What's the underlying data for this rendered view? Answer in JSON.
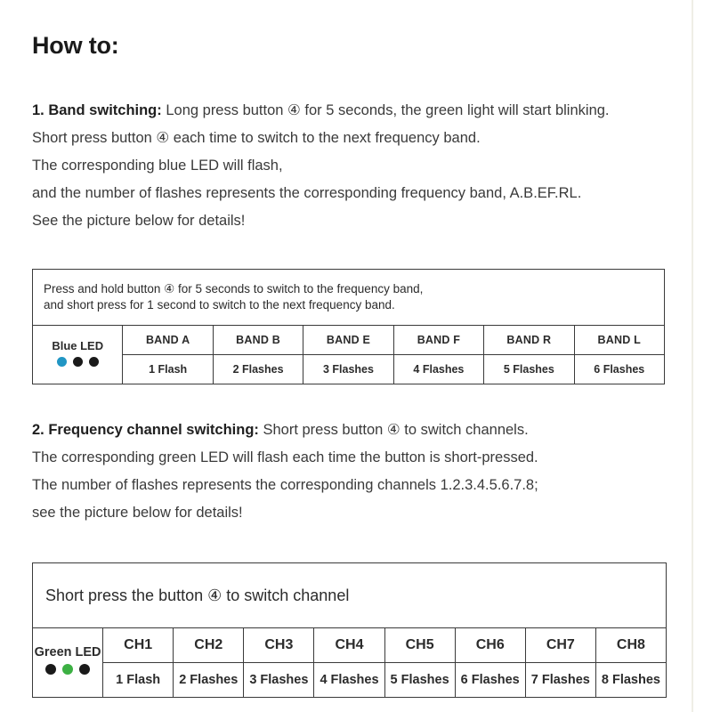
{
  "page": {
    "title": "How to:"
  },
  "section1": {
    "lead": "1. Band switching:",
    "line1_rest": " Long press button ④ for 5 seconds, the green light will start blinking.",
    "line2": "Short press button ④ each time to switch to the next frequency band.",
    "line3": "The corresponding blue LED will flash,",
    "line4": "and the number of flashes represents the corresponding frequency band, A.B.EF.RL.",
    "line5": "See the picture below for details!"
  },
  "band_table": {
    "note_line1": "Press and hold button ④ for 5 seconds to switch to the frequency band,",
    "note_line2": "and short press for 1 second to switch to the next frequency band.",
    "led_label": "Blue LED",
    "led_colors": [
      "#2196c4",
      "#1a1a1a",
      "#1a1a1a"
    ],
    "bands": [
      "BAND A",
      "BAND B",
      "BAND E",
      "BAND F",
      "BAND R",
      "BAND L"
    ],
    "flashes": [
      "1 Flash",
      "2 Flashes",
      "3 Flashes",
      "4 Flashes",
      "5 Flashes",
      "6 Flashes"
    ]
  },
  "section2": {
    "lead": "2. Frequency channel switching:",
    "line1_rest": " Short press button ④ to switch channels.",
    "line2": "The corresponding green LED will flash each time the button is short-pressed.",
    "line3": "The number of flashes represents the corresponding channels  1.2.3.4.5.6.7.8;",
    "line4": "see the picture below for details!"
  },
  "channel_table": {
    "note": "Short press the button ④ to switch channel",
    "led_label": "Green LED",
    "led_colors": [
      "#1a1a1a",
      "#3cb043",
      "#1a1a1a"
    ],
    "channels": [
      "CH1",
      "CH2",
      "CH3",
      "CH4",
      "CH5",
      "CH6",
      "CH7",
      "CH8"
    ],
    "flashes": [
      "1 Flash",
      "2 Flashes",
      "3 Flashes",
      "4 Flashes",
      "5 Flashes",
      "6 Flashes",
      "7 Flashes",
      "8 Flashes"
    ]
  }
}
